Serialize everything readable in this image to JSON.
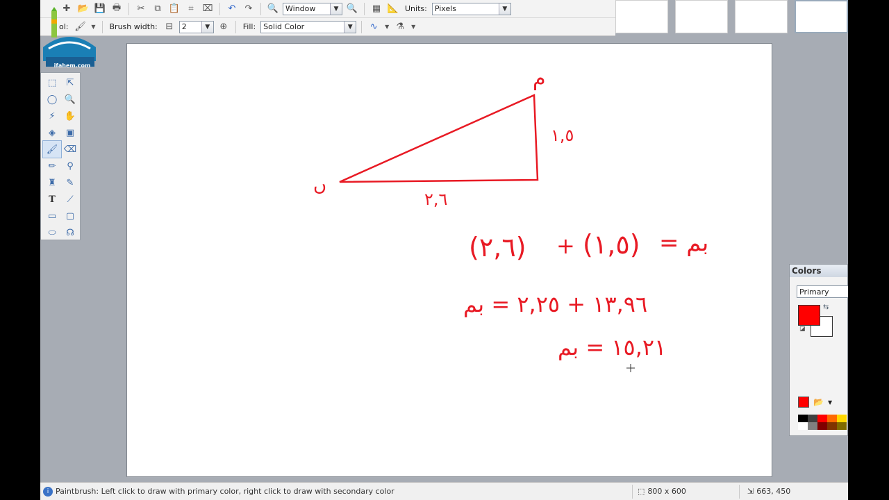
{
  "toolbar": {
    "zoom_value": "Window",
    "units_label": "Units:",
    "units_value": "Pixels",
    "tool_label": "ol:",
    "brush_width_label": "Brush width:",
    "brush_width_value": "2",
    "fill_label": "Fill:",
    "fill_value": "Solid Color"
  },
  "logo": {
    "text": "ifahem.com"
  },
  "canvas_drawing": {
    "vertex_top": "م",
    "vertex_left": "ں",
    "side_right": "١,٥",
    "side_bottom": "٢,٦",
    "eq1_left": "(٢,٦)",
    "eq1_mid": "+",
    "eq1_right": "(١,٥)",
    "eq1_rhs": "= بم",
    "eq2": "١٣,٩٦ + ٢,٢٥ = بم",
    "eq3": "١٥,٢١ = بم",
    "stroke_color": "#e81a24"
  },
  "colors_panel": {
    "title": "Colors",
    "mode": "Primary",
    "primary_color": "#ff0000",
    "secondary_color": "#ffffff"
  },
  "status": {
    "message": "Paintbrush: Left click to draw with primary color, right click to draw with secondary color",
    "image_size": "800 x 600",
    "cursor_position": "663, 450"
  }
}
